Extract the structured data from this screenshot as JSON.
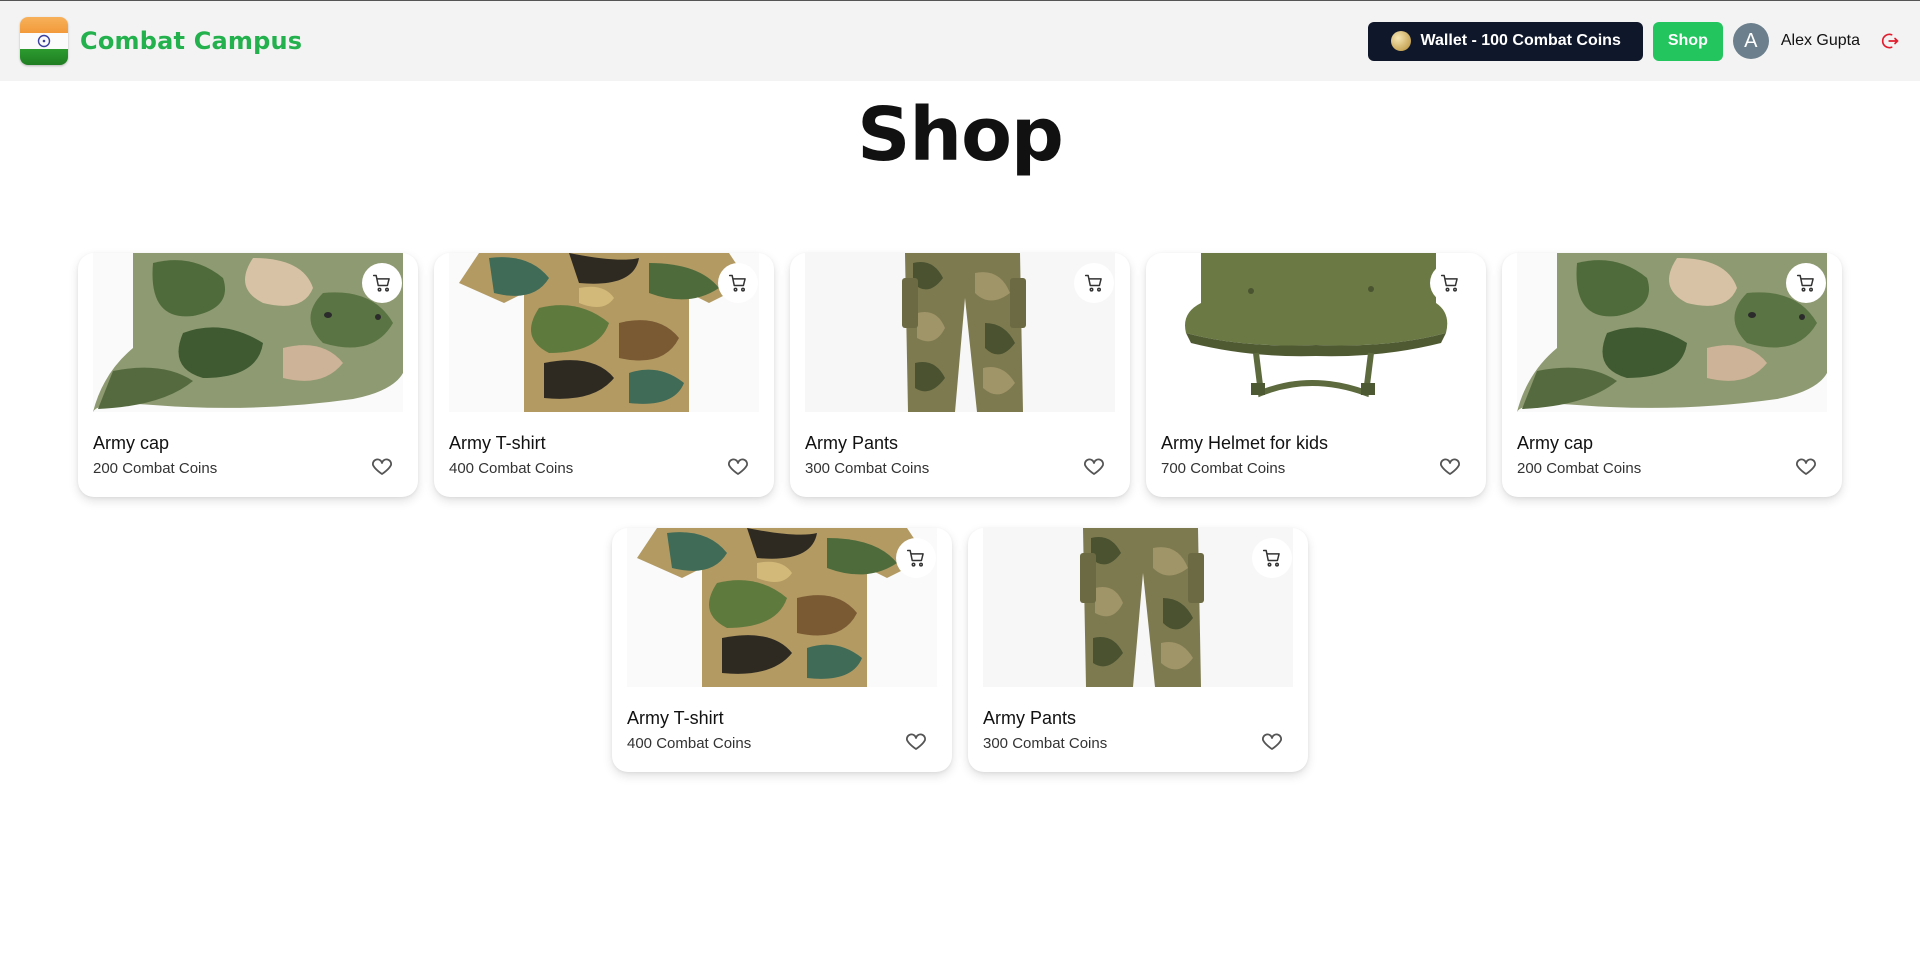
{
  "header": {
    "brand": "Combat Campus",
    "wallet_label": "Wallet - 100 Combat Coins",
    "shop_label": "Shop",
    "avatar_initial": "A",
    "user_name": "Alex Gupta"
  },
  "page": {
    "title": "Shop"
  },
  "products": [
    {
      "name": "Army cap",
      "price": "200 Combat Coins",
      "image": "camo-cap"
    },
    {
      "name": "Army T-shirt",
      "price": "400 Combat Coins",
      "image": "camo-tshirt"
    },
    {
      "name": "Army Pants",
      "price": "300 Combat Coins",
      "image": "camo-pants"
    },
    {
      "name": "Army Helmet for kids",
      "price": "700 Combat Coins",
      "image": "helmet"
    },
    {
      "name": "Army cap",
      "price": "200 Combat Coins",
      "image": "camo-cap"
    },
    {
      "name": "Army T-shirt",
      "price": "400 Combat Coins",
      "image": "camo-tshirt"
    },
    {
      "name": "Army Pants",
      "price": "300 Combat Coins",
      "image": "camo-pants"
    }
  ],
  "icons": {
    "cart": "cart-icon",
    "favorite": "heart-icon",
    "logout": "logout-icon",
    "coin": "coin-icon"
  },
  "colors": {
    "brand_green": "#22b14c",
    "shop_button": "#22c55e",
    "wallet_bg": "#0f172a",
    "header_bg": "#f3f3f3",
    "logout_red": "#e11d2e"
  }
}
